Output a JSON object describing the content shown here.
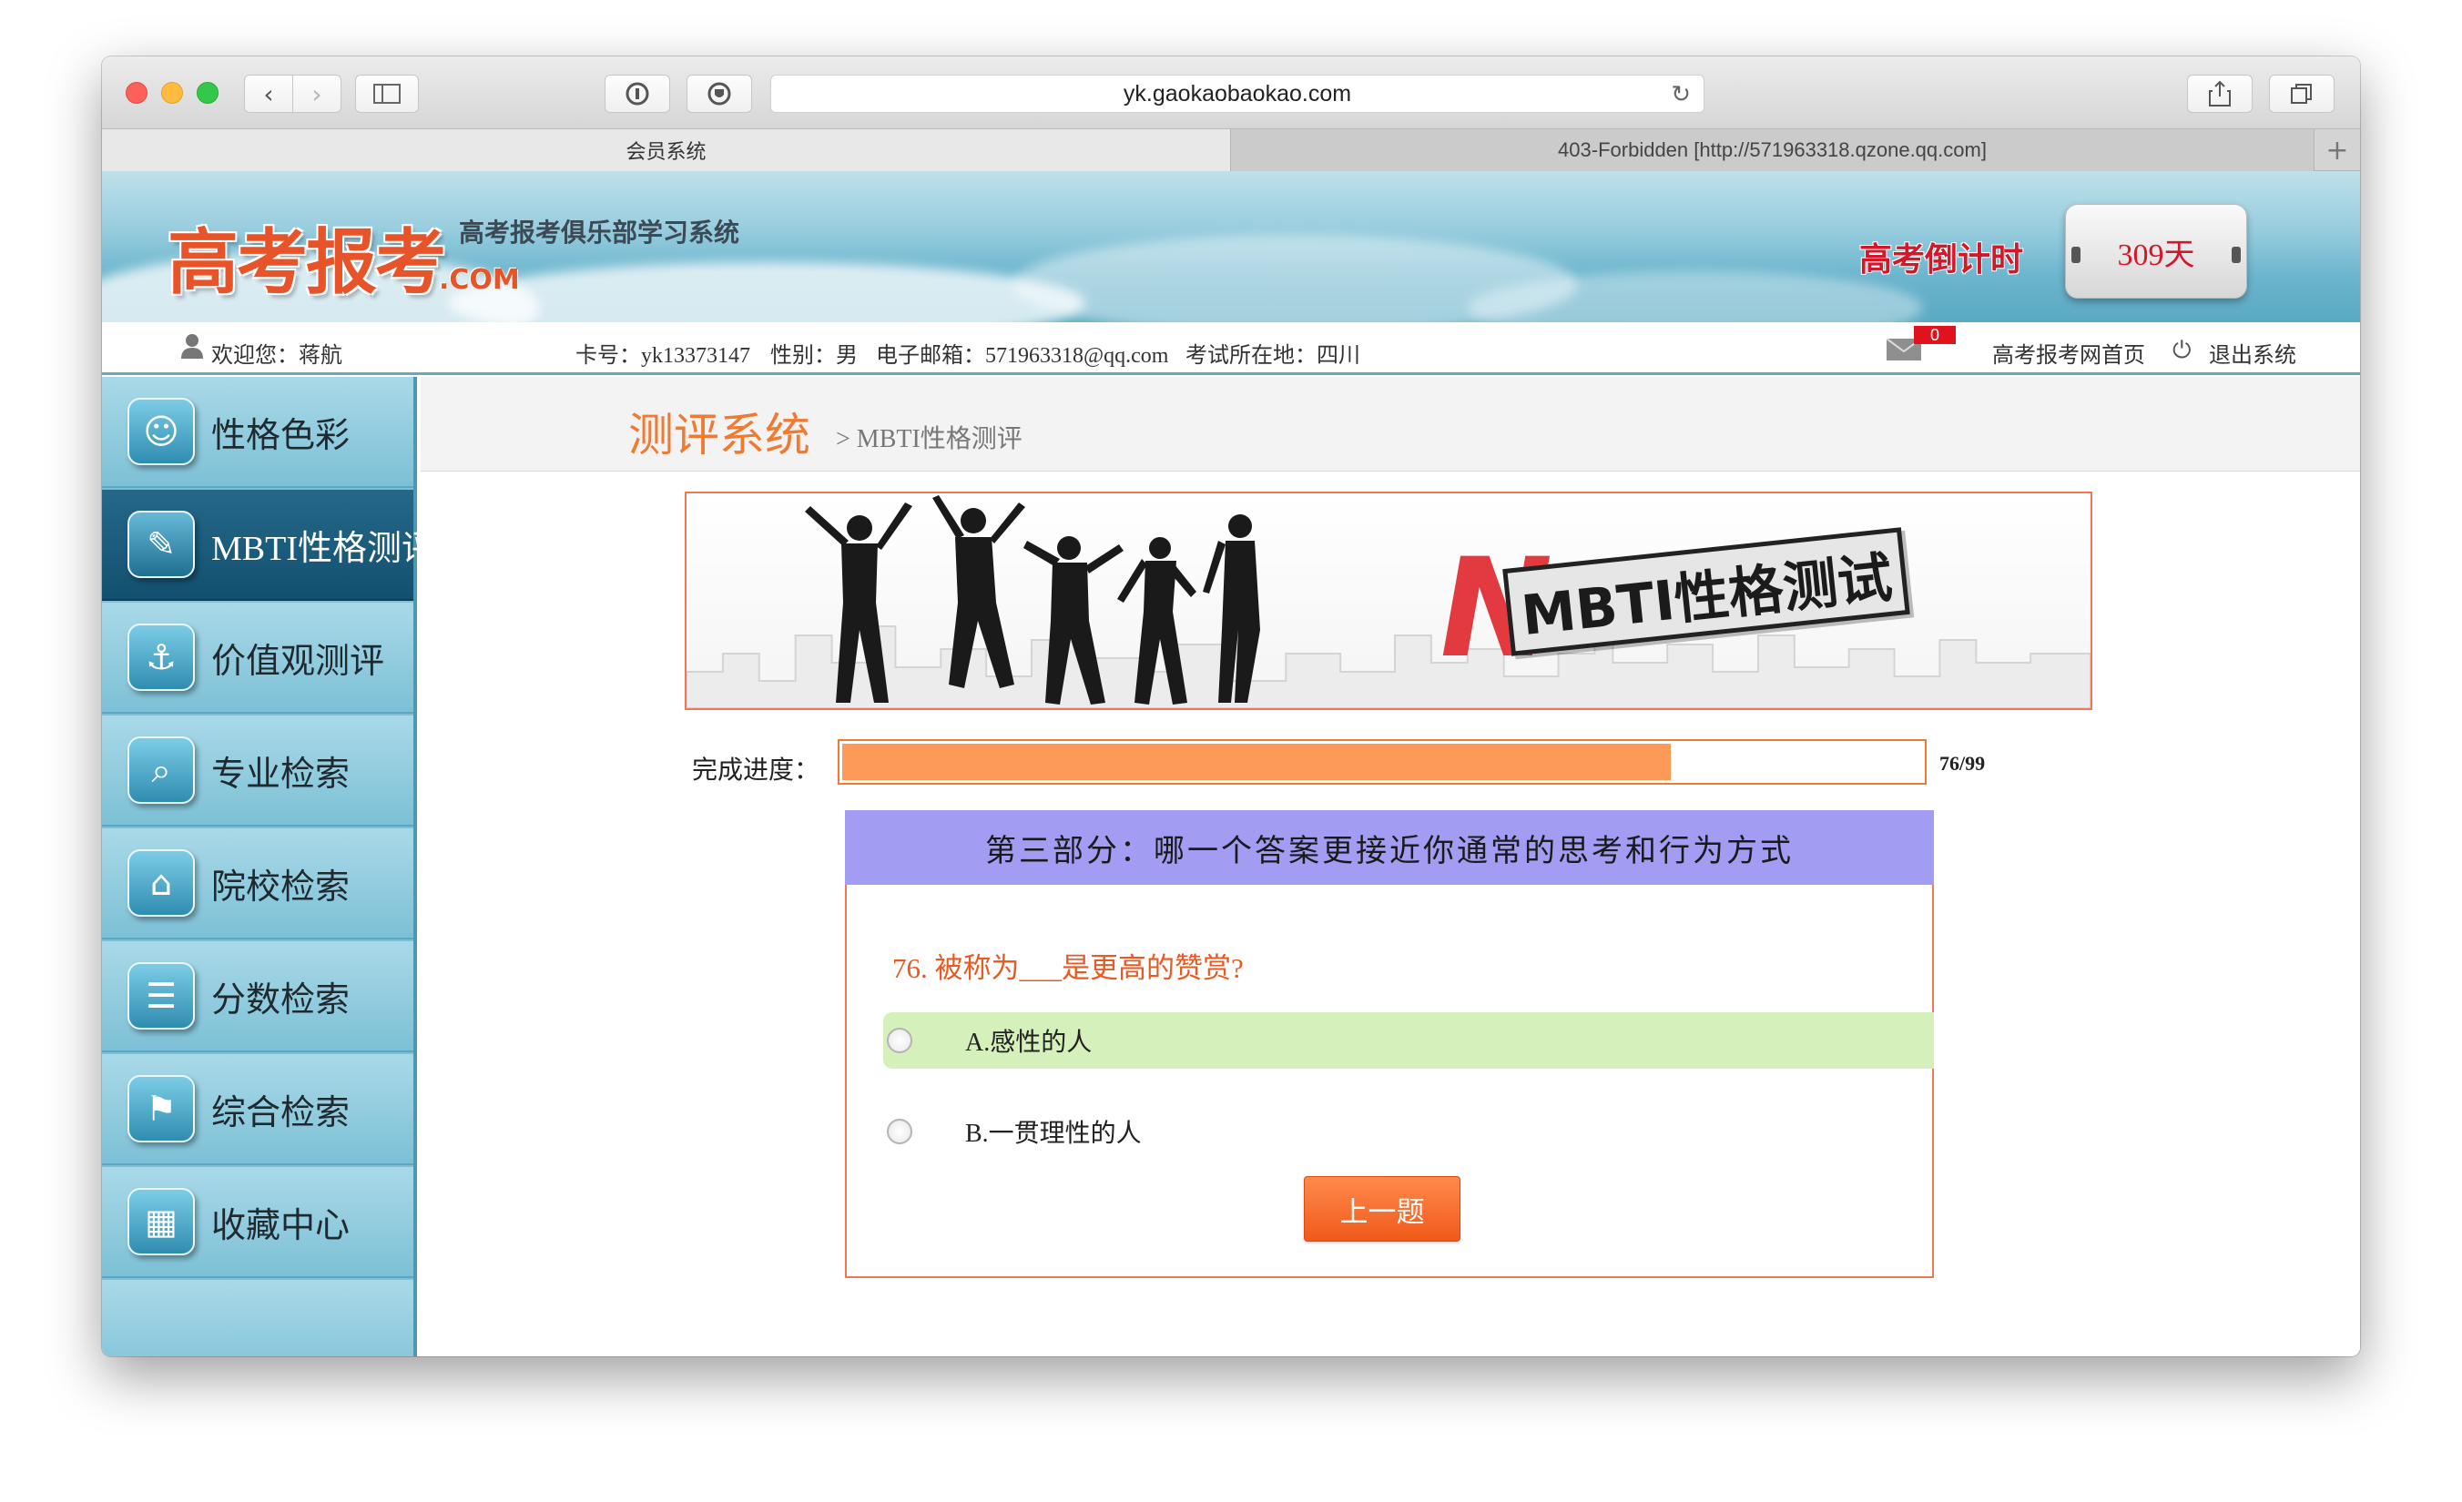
{
  "browser": {
    "url": "yk.gaokaobaokao.com",
    "tabs": [
      {
        "label": "会员系统"
      },
      {
        "label": "403-Forbidden [http://571963318.qzone.qq.com]"
      }
    ],
    "new_tab_label": "+"
  },
  "header": {
    "logo_text": "高考报考",
    "logo_suffix": ".COM",
    "subtitle": "高考报考俱乐部学习系统",
    "countdown_label": "高考倒计时",
    "countdown_value": "309天"
  },
  "infobar": {
    "welcome": "欢迎您：蒋航",
    "card_no": "卡号：yk13373147",
    "gender": "性别：男",
    "email": "电子邮箱：571963318@qq.com",
    "exam_location": "考试所在地：四川",
    "mail_count": "0",
    "home_link": "高考报考网首页",
    "logout_link": "退出系统"
  },
  "sidebar": {
    "items": [
      {
        "label": "性格色彩",
        "icon": "mask-icon",
        "active": false
      },
      {
        "label": "MBTI性格测评",
        "icon": "feather-icon",
        "active": true
      },
      {
        "label": "价值观测评",
        "icon": "anchor-icon",
        "active": false
      },
      {
        "label": "专业检索",
        "icon": "document-search-icon",
        "active": false
      },
      {
        "label": "院校检索",
        "icon": "school-search-icon",
        "active": false
      },
      {
        "label": "分数检索",
        "icon": "list-icon",
        "active": false
      },
      {
        "label": "综合检索",
        "icon": "signpost-icon",
        "active": false
      },
      {
        "label": "收藏中心",
        "icon": "building-icon",
        "active": false
      }
    ]
  },
  "content": {
    "section_title": "测评系统",
    "breadcrumb": "> MBTI性格测评",
    "banner_text": "MBTI性格测试",
    "progress": {
      "label": "完成进度：",
      "current": 76,
      "total": 99,
      "text": "76/99",
      "fraction": 0.7677
    },
    "part_header": "第三部分：哪一个答案更接近你通常的思考和行为方式",
    "question": "76. 被称为___是更高的赞赏?",
    "options": [
      {
        "label": "A.感性的人",
        "highlighted": true
      },
      {
        "label": "B.一贯理性的人",
        "highlighted": false
      }
    ],
    "prev_button": "上一题"
  },
  "colors": {
    "accent_orange": "#f07a31",
    "part_header_bg": "#a29cf3",
    "highlight_option": "#d6f0bb",
    "sidebar_bg": "#7bc0d6",
    "sidebar_active": "#13506f"
  }
}
